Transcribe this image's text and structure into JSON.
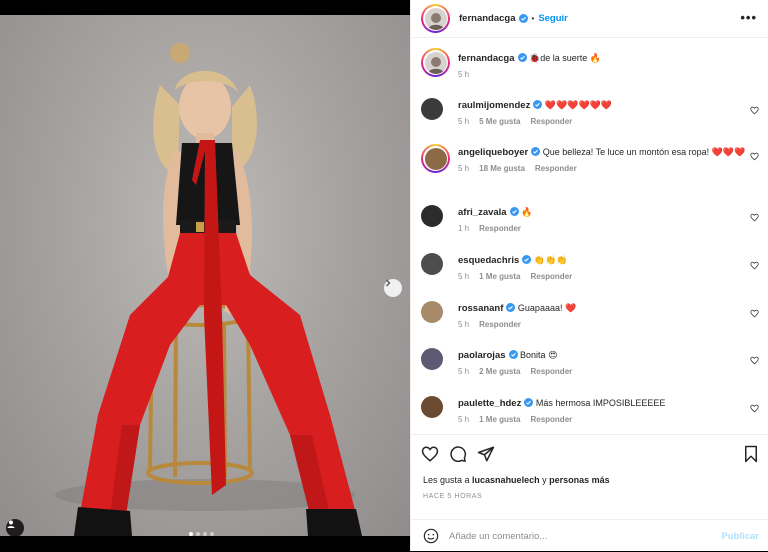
{
  "post": {
    "username": "fernandacga",
    "follow_label": "Seguir",
    "separator": "•",
    "more_label": "•••",
    "carousel": {
      "current": 1,
      "total": 4
    }
  },
  "caption": {
    "username": "fernandacga",
    "text": "🐞de la suerte 🔥",
    "time": "5 h"
  },
  "comments": [
    {
      "username": "raulmijomendez",
      "text": "❤️❤️❤️❤️❤️❤️",
      "time": "5 h",
      "likes": "5 Me gusta",
      "reply": "Responder"
    },
    {
      "username": "angeliqueboyer",
      "text": "Que belleza! Te luce un montón esa ropa! ❤️❤️❤️",
      "time": "5 h",
      "likes": "18 Me gusta",
      "reply": "Responder"
    },
    {
      "username": "afri_zavala",
      "text": "🔥",
      "time": "1 h",
      "likes": "",
      "reply": "Responder"
    },
    {
      "username": "esquedachris",
      "text": "👏👏👏",
      "time": "5 h",
      "likes": "1 Me gusta",
      "reply": "Responder"
    },
    {
      "username": "rossananf",
      "text": "Guapaaaa! ❤️",
      "time": "5 h",
      "likes": "",
      "reply": "Responder"
    },
    {
      "username": "paolarojas",
      "text": "Bonita 😍",
      "time": "5 h",
      "likes": "2 Me gusta",
      "reply": "Responder"
    },
    {
      "username": "paulette_hdez",
      "text": "Más hermosa IMPOSIBLEEEEE",
      "time": "5 h",
      "likes": "1 Me gusta",
      "reply": "Responder"
    }
  ],
  "likes_line": {
    "prefix": "Les gusta a ",
    "user": "lucasnahuelech",
    "middle": " y ",
    "suffix": "personas más"
  },
  "post_time": "HACE 5 HORAS",
  "add_comment": {
    "placeholder": "Añade un comentario...",
    "publish_label": "Publicar"
  },
  "colors": {
    "accent": "#0095f6",
    "verified": "#3897f0",
    "heart": "#ed4956",
    "muted": "#8e8e8e",
    "dress": "#d81e1e"
  }
}
